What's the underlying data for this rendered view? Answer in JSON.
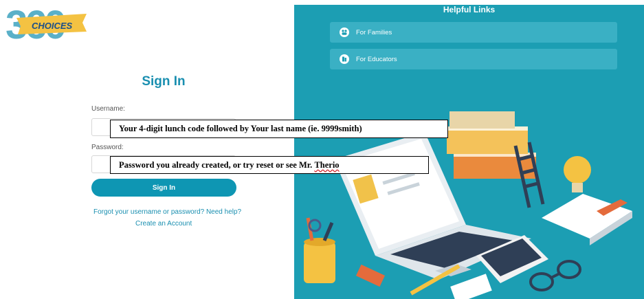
{
  "logo": {
    "number": "360",
    "ribbon_text": "CHOICES"
  },
  "signin": {
    "title": "Sign In",
    "username_label": "Username:",
    "password_label": "Password:",
    "button_label": "Sign In",
    "forgot_link": "Forgot your username or password? Need help?",
    "create_link": "Create an Account"
  },
  "helpful_links": {
    "title": "Helpful Links",
    "items": [
      {
        "label": "For Families",
        "icon": "family-icon"
      },
      {
        "label": "For Educators",
        "icon": "educator-icon"
      }
    ]
  },
  "notes": {
    "username_prefix": "Your 4-digit lunch code followed by Your last name (ie. 9999smith)",
    "password_prefix": "Password you already created, or try reset or see Mr. ",
    "password_name": "Therio"
  },
  "colors": {
    "brand_teal": "#1c9eb3",
    "button_teal": "#0e96b3",
    "logo_yellow": "#f4c242",
    "logo_blue": "#5ab0c8"
  }
}
